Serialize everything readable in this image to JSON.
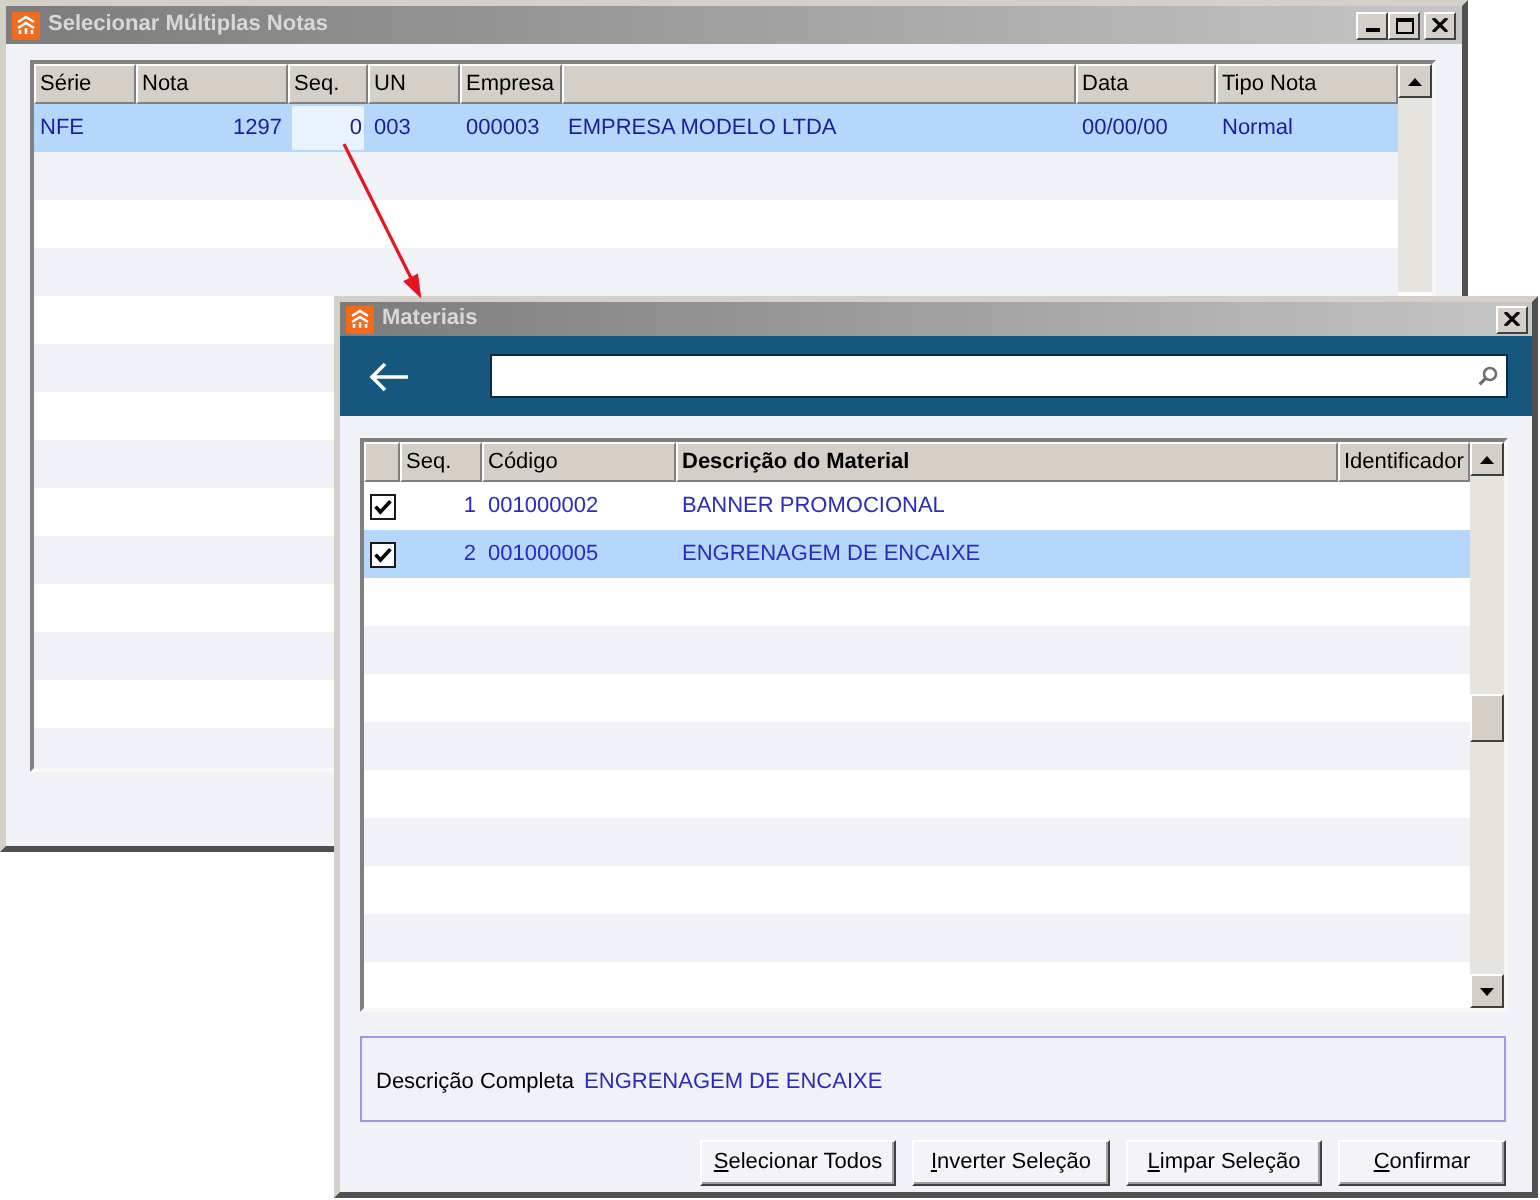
{
  "main_window": {
    "title": "Selecionar Múltiplas Notas",
    "columns": [
      {
        "label": "Série"
      },
      {
        "label": "Nota"
      },
      {
        "label": "Seq."
      },
      {
        "label": "UN"
      },
      {
        "label": "Empresa"
      },
      {},
      {
        "label": "Data"
      },
      {
        "label": "Tipo Nota"
      }
    ],
    "rows": [
      {
        "selected": true,
        "cells": [
          {
            "text": "NFE",
            "focused": false
          },
          {
            "text": "1297",
            "focused": false
          },
          {
            "text": "0",
            "focused": true
          },
          {
            "text": "003",
            "focused": false
          },
          {
            "text": "000003",
            "focused": false
          },
          {
            "text": "EMPRESA MODELO LTDA",
            "focused": false
          },
          {
            "text": "00/00/00",
            "focused": false
          },
          {
            "text": "Normal",
            "focused": false
          }
        ]
      }
    ]
  },
  "materials_window": {
    "title": "Materiais",
    "columns": [
      {
        "label": "Seq.",
        "sorted": false
      },
      {
        "label": "Código",
        "sorted": false
      },
      {
        "label": "Descrição do Material",
        "sorted": true
      },
      {
        "label": "Identificador",
        "sorted": false
      }
    ],
    "rows": [
      {
        "checked": true,
        "selected": false,
        "cells": [
          "1",
          "001000002",
          "BANNER PROMOCIONAL"
        ]
      },
      {
        "checked": true,
        "selected": true,
        "cells": [
          "2",
          "001000005",
          "ENGRENAGEM DE ENCAIXE"
        ]
      }
    ],
    "detail": {
      "label": "Descrição Completa",
      "value": "ENGRENAGEM DE ENCAIXE"
    },
    "buttons": [
      "Selecionar Todos",
      "Inverter Seleção",
      "Limpar Seleção",
      "Confirmar"
    ]
  }
}
